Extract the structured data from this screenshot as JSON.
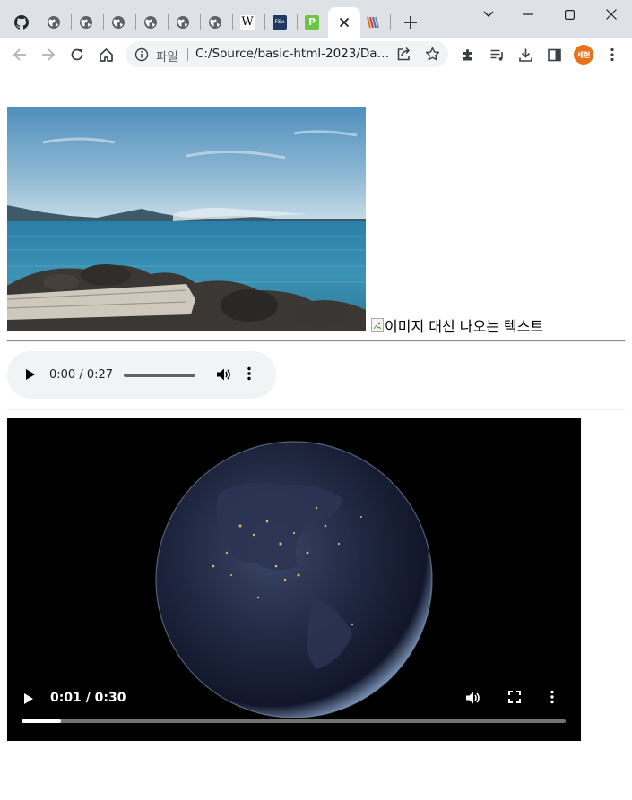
{
  "browser": {
    "tabs": [
      {
        "icon": "github-icon"
      },
      {
        "icon": "globe-icon"
      },
      {
        "icon": "globe-icon"
      },
      {
        "icon": "globe-icon"
      },
      {
        "icon": "globe-icon"
      },
      {
        "icon": "globe-icon"
      },
      {
        "icon": "globe-icon"
      },
      {
        "icon": "wikipedia-icon",
        "glyph": "W"
      },
      {
        "icon": "fex-icon",
        "glyph": "FEx"
      },
      {
        "icon": "p-app-icon",
        "glyph": "P"
      },
      {
        "icon": "close-icon",
        "active": true
      },
      {
        "icon": "striped-logo-icon"
      }
    ],
    "new_tab_glyph": "+",
    "address": {
      "scheme_label": "파일",
      "url": "C:/Source/basic-html-2023/Day..."
    },
    "profile_label": "세현"
  },
  "page": {
    "image": {
      "description_icon": "seascape-photo",
      "broken_alt_text": "이미지 대신 나오는 텍스트"
    },
    "audio": {
      "current": "0:00",
      "duration": "0:27",
      "time_text": "0:00 / 0:27",
      "progress": 0.0
    },
    "video": {
      "current": "0:01",
      "duration": "0:30",
      "time_text": "0:01 / 0:30",
      "progress": 0.073
    }
  },
  "colors": {
    "tabstrip": "#dee1e6",
    "omnibox": "#f1f3f4",
    "profile": "#e8711a",
    "audio_bg": "#f1f3f4",
    "video_bg": "#000000"
  }
}
